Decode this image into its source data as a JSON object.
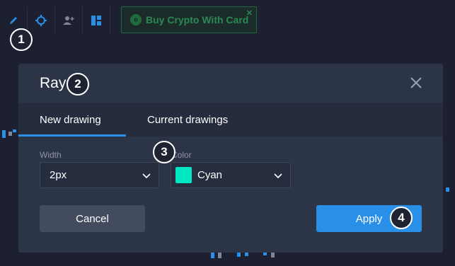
{
  "toolbar": {
    "tools": [
      {
        "icon": "pencil-icon"
      },
      {
        "icon": "crosshair-icon"
      },
      {
        "icon": "add-user-icon"
      },
      {
        "icon": "layout-icon"
      }
    ],
    "buy_button": {
      "label": "Buy Crypto With Card",
      "icon": "coin-icon",
      "close": "✕"
    }
  },
  "badges": [
    "1",
    "2",
    "3",
    "4"
  ],
  "dialog": {
    "title": "Ray",
    "tabs": [
      {
        "label": "New drawing",
        "active": true
      },
      {
        "label": "Current drawings",
        "active": false
      }
    ],
    "width": {
      "label": "Width",
      "value": "2px"
    },
    "color": {
      "label": "Color",
      "value": "Cyan",
      "swatch": "#00e8c2"
    },
    "cancel_label": "Cancel",
    "apply_label": "Apply"
  },
  "colors": {
    "background": "#1c2030",
    "dialog": "#2c3447",
    "accent": "#2a8fe6",
    "buy_green": "#2a8a52"
  }
}
